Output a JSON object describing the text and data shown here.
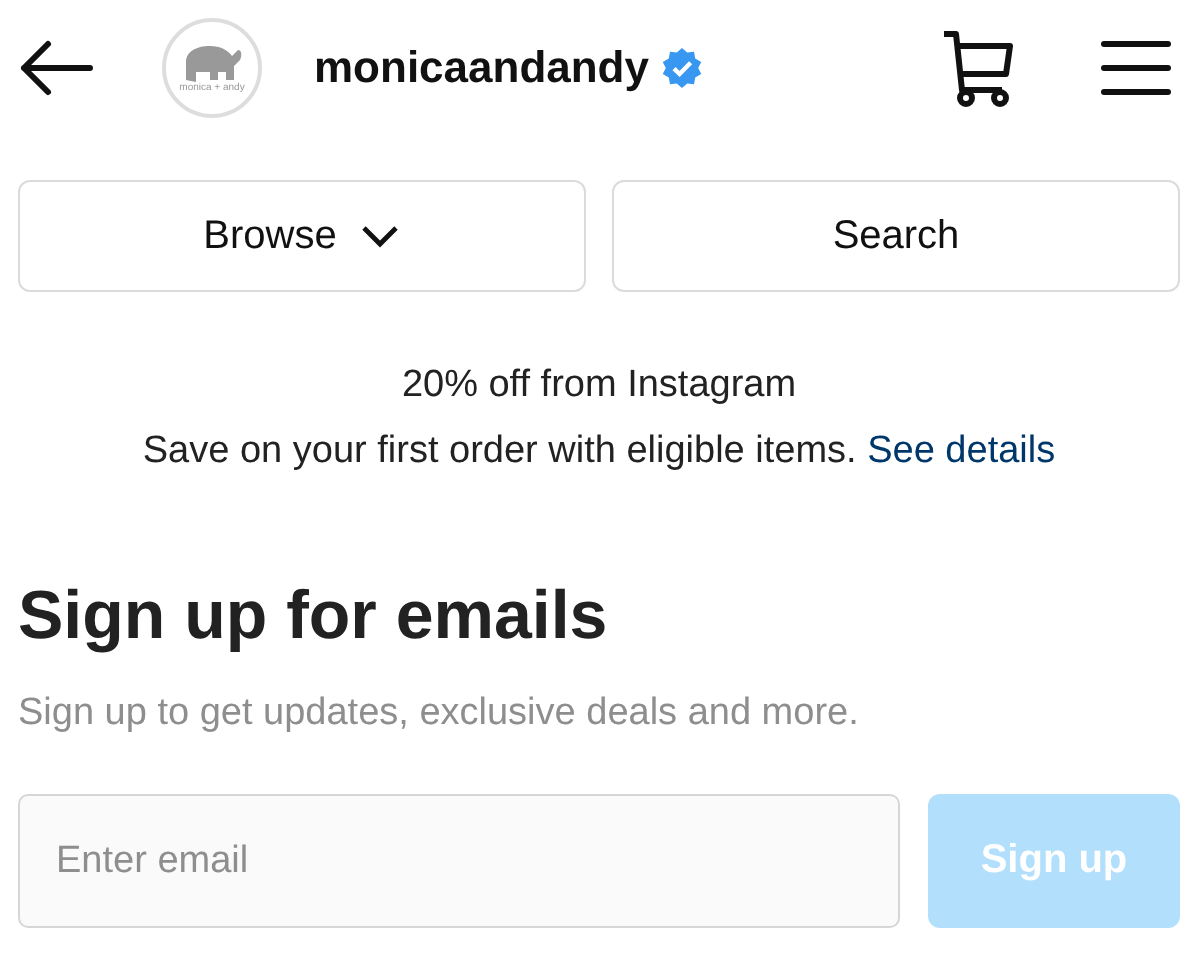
{
  "header": {
    "avatar_caption": "monica + andy",
    "username": "monicaandandy",
    "verified": true
  },
  "actions": [
    {
      "label": "Browse",
      "kind": "dropdown"
    },
    {
      "label": "Search",
      "kind": "plain"
    }
  ],
  "promo": {
    "title": "20% off from Instagram",
    "text": "Save on your first order with eligible items.",
    "link": "See details"
  },
  "signup": {
    "heading": "Sign up for emails",
    "subtitle": "Sign up to get updates, exclusive deals and more.",
    "email": {
      "placeholder": "Enter email"
    },
    "button": {
      "label": "Sign up",
      "disabled": true
    }
  }
}
